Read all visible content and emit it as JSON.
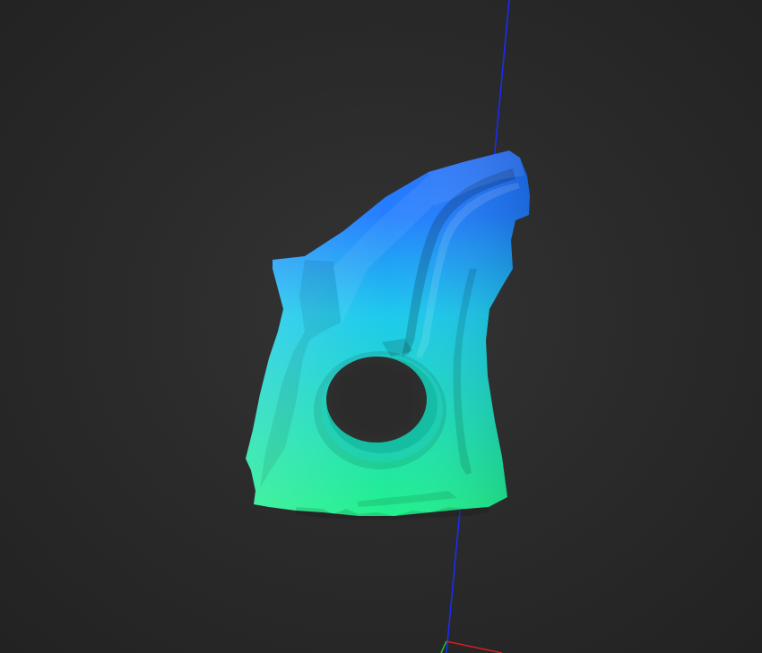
{
  "viewer": {
    "background_color": "#2a2a2a",
    "axes": {
      "z_axis_color": "#1c2bff",
      "x_axis_color": "#e01b1b",
      "y_axis_color": "#21c421"
    },
    "model": {
      "gradient": {
        "top_color": "#1f6dff",
        "middle_color": "#19c8ec",
        "bottom_color": "#1df08a"
      }
    }
  }
}
